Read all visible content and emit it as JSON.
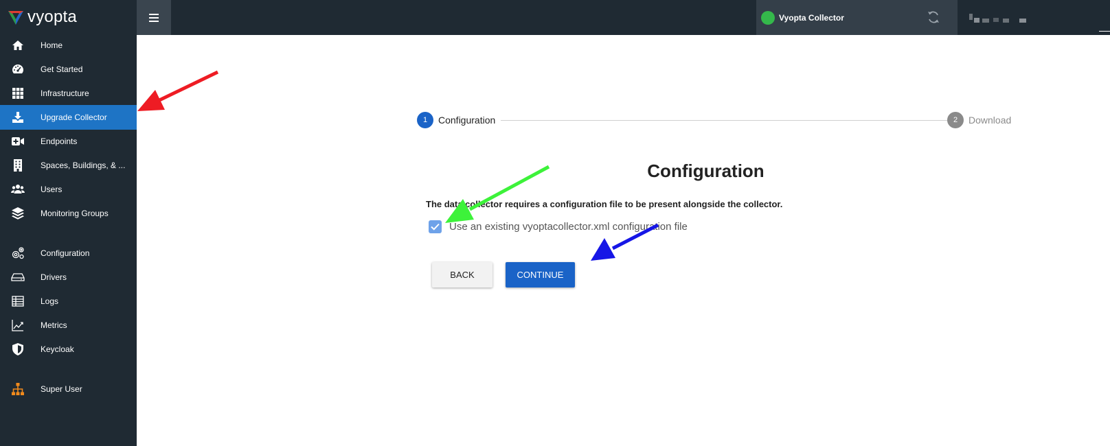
{
  "app": {
    "logo_text": "vyopta",
    "brand_colors": [
      "#e03c31",
      "#2d9a46",
      "#2567c8"
    ]
  },
  "sidebar": {
    "items": [
      {
        "label": "Home",
        "icon": "home-icon",
        "active": false
      },
      {
        "label": "Get Started",
        "icon": "dashboard-gauge-icon",
        "active": false
      },
      {
        "label": "Infrastructure",
        "icon": "grid-icon",
        "active": false
      },
      {
        "label": "Upgrade Collector",
        "icon": "download-icon",
        "active": true
      },
      {
        "label": "Endpoints",
        "icon": "video-camera-plus-icon",
        "active": false
      },
      {
        "label": "Spaces, Buildings, & ...",
        "icon": "building-icon",
        "active": false
      },
      {
        "label": "Users",
        "icon": "users-icon",
        "active": false
      },
      {
        "label": "Monitoring Groups",
        "icon": "layers-icon",
        "active": false
      },
      {
        "label": "Configuration",
        "icon": "gears-icon",
        "active": false
      },
      {
        "label": "Drivers",
        "icon": "hard-drive-icon",
        "active": false
      },
      {
        "label": "Logs",
        "icon": "table-icon",
        "active": false
      },
      {
        "label": "Metrics",
        "icon": "line-chart-icon",
        "active": false
      },
      {
        "label": "Keycloak",
        "icon": "shield-icon",
        "active": false
      },
      {
        "label": "Super User",
        "icon": "org-chart-icon",
        "active": false
      }
    ]
  },
  "topbar": {
    "collector_name": "Vyopta Collector",
    "status_color": "#34b84b"
  },
  "stepper": {
    "steps": [
      {
        "number": "1",
        "label": "Configuration",
        "active": true
      },
      {
        "number": "2",
        "label": "Download",
        "active": false
      }
    ]
  },
  "main": {
    "heading": "Configuration",
    "description": "The data collector requires a configuration file to be present alongside the collector.",
    "checkbox_label": "Use an existing vyoptacollector.xml configuration file",
    "checkbox_checked": true,
    "back_label": "BACK",
    "continue_label": "CONTINUE"
  },
  "annotations": {
    "arrow_colors": [
      "#ee1c24",
      "#3df23a",
      "#1616e6"
    ]
  }
}
